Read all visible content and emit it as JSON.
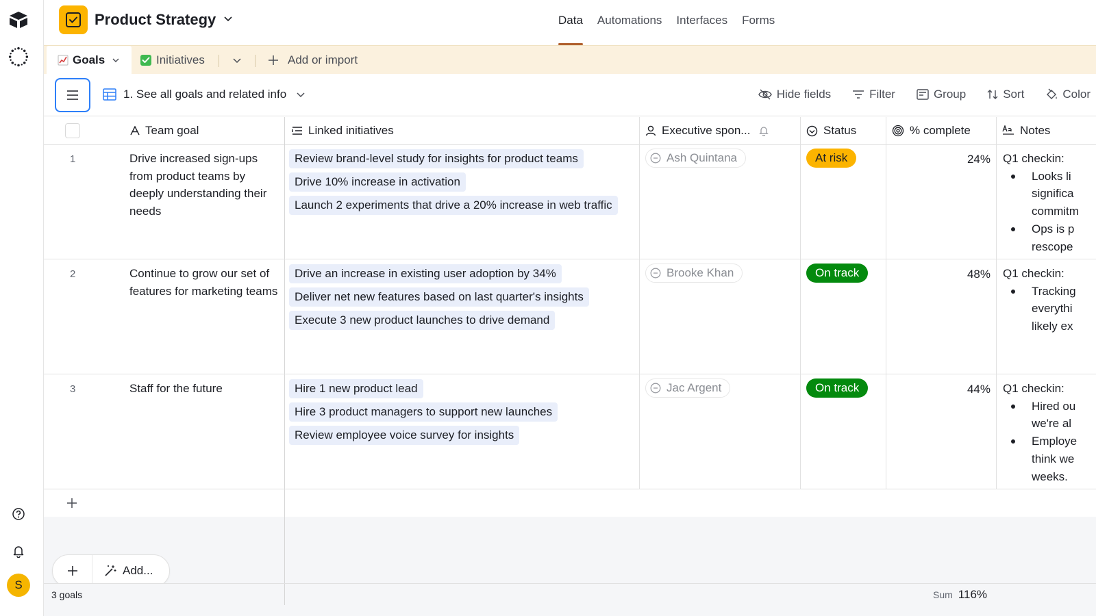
{
  "base": {
    "title": "Product Strategy"
  },
  "nav": {
    "tabs": [
      "Data",
      "Automations",
      "Interfaces",
      "Forms"
    ],
    "active": "Data"
  },
  "tables": {
    "goals": "Goals",
    "initiatives": "Initiatives",
    "add_or_import": "Add or import"
  },
  "view": {
    "name": "1. See all goals and related info"
  },
  "toolbar": {
    "hide_fields": "Hide fields",
    "filter": "Filter",
    "group": "Group",
    "sort": "Sort",
    "color": "Color"
  },
  "columns": {
    "team_goal": "Team goal",
    "linked_initiatives": "Linked initiatives",
    "executive_sponsor": "Executive spon...",
    "status": "Status",
    "percent_complete": "% complete",
    "notes": "Notes"
  },
  "rows": [
    {
      "num": "1",
      "goal": "Drive increased sign-ups from product teams by deeply understanding their needs",
      "initiatives": [
        "Review brand-level study for insights for product teams",
        "Drive 10% increase in activation",
        "Launch 2 experiments that drive a 20% increase in web traffic"
      ],
      "sponsor": "Ash Quintana",
      "status": "At risk",
      "percent": "24%",
      "notes_title": "Q1 checkin:",
      "notes_items": [
        [
          "Looks li",
          "significa",
          "commitm"
        ],
        [
          "Ops is p",
          "rescope"
        ]
      ]
    },
    {
      "num": "2",
      "goal": "Continue to grow our set of features for marketing teams",
      "initiatives": [
        "Drive an increase in existing user adoption by 34%",
        "Deliver net new features based on last quarter's insights",
        "Execute 3 new product launches to drive demand"
      ],
      "sponsor": "Brooke Khan",
      "status": "On track",
      "percent": "48%",
      "notes_title": "Q1 checkin:",
      "notes_items": [
        [
          "Tracking",
          "everythi",
          "likely ex"
        ]
      ]
    },
    {
      "num": "3",
      "goal": "Staff for the future",
      "initiatives": [
        "Hire 1 new product lead",
        "Hire 3 product managers to support new launches",
        "Review employee voice survey for insights"
      ],
      "sponsor": "Jac Argent",
      "status": "On track",
      "percent": "44%",
      "notes_title": "Q1 checkin:",
      "notes_items": [
        [
          "Hired ou",
          "we're al"
        ],
        [
          "Employe",
          "think we",
          "weeks."
        ]
      ]
    }
  ],
  "add_button": "Add...",
  "footer": {
    "count": "3 goals",
    "sum_label": "Sum",
    "sum_value": "116%"
  },
  "user": {
    "initial": "S"
  },
  "colors": {
    "at_risk": "#fcb400",
    "on_track": "#048a0e",
    "accent": "#2d7ff9",
    "base_icon": "#fcb400"
  }
}
